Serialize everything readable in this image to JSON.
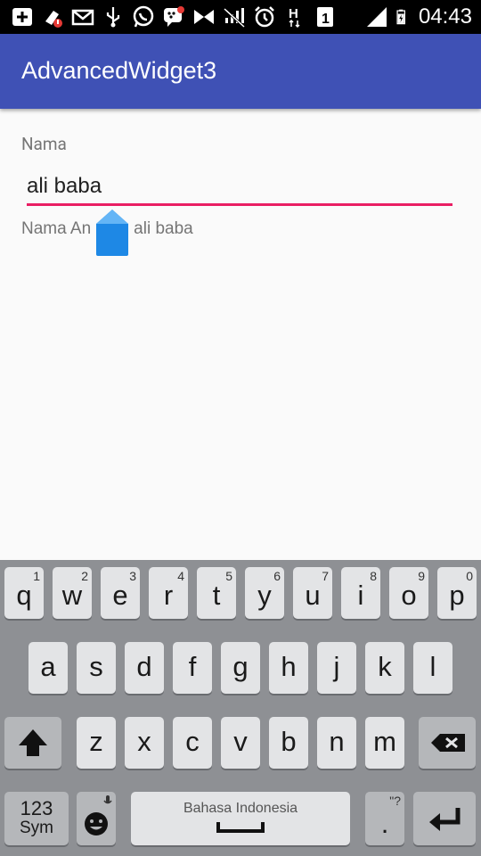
{
  "status_bar": {
    "time": "04:43",
    "icons": [
      "add-box-icon",
      "cleaner-alert-icon",
      "mail-icon",
      "usb-icon",
      "whatsapp-icon",
      "bbm-icon",
      "bow-tie-icon",
      "no-signal-icon",
      "alarm-icon",
      "h-data-icon",
      "sim-1-icon",
      "signal-icon",
      "battery-icon"
    ]
  },
  "app_bar": {
    "title": "AdvancedWidget3"
  },
  "form": {
    "label": "Nama",
    "input_value": "ali baba",
    "output_prefix": "Nama An",
    "output_value": "ali baba"
  },
  "keyboard": {
    "row1": [
      {
        "k": "q",
        "h": "1"
      },
      {
        "k": "w",
        "h": "2"
      },
      {
        "k": "e",
        "h": "3"
      },
      {
        "k": "r",
        "h": "4"
      },
      {
        "k": "t",
        "h": "5"
      },
      {
        "k": "y",
        "h": "6"
      },
      {
        "k": "u",
        "h": "7"
      },
      {
        "k": "i",
        "h": "8"
      },
      {
        "k": "o",
        "h": "9"
      },
      {
        "k": "p",
        "h": "0"
      }
    ],
    "row2": [
      "a",
      "s",
      "d",
      "f",
      "g",
      "h",
      "j",
      "k",
      "l"
    ],
    "row3": [
      "z",
      "x",
      "c",
      "v",
      "b",
      "n",
      "m"
    ],
    "sym_line1": "123",
    "sym_line2": "Sym",
    "space_label": "Bahasa Indonesia",
    "period": ".",
    "period_hint": "\"?",
    "colors": {
      "background": "#8e9094",
      "key": "#e3e4e6",
      "special_key": "#b5b7ba"
    }
  },
  "colors": {
    "app_bar": "#3f51b5",
    "accent": "#e91e63",
    "handle": "#2196f3"
  }
}
